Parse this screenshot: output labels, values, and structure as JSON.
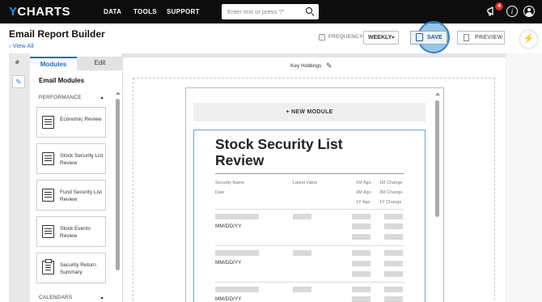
{
  "nav": {
    "logo_y": "Y",
    "logo_rest": "CHARTS",
    "links": [
      "DATA",
      "TOOLS",
      "SUPPORT"
    ],
    "search_placeholder": "Enter text or press \"/\"",
    "notification_count": "4",
    "info_glyph": "i"
  },
  "header": {
    "title": "Email Report Builder",
    "view_all": "View All",
    "frequency_label": "FREQUENCY:",
    "frequency_help": "?",
    "frequency_value": "WEEKLY",
    "save_label": "SAVE",
    "preview_label": "PREVIEW",
    "bolt_glyph": "⚡"
  },
  "rail": {
    "link_glyph": "🔗",
    "edit_glyph": "✎"
  },
  "panel": {
    "tabs": [
      "Modules",
      "Edit"
    ],
    "title": "Email Modules",
    "sections": [
      "PERFORMANCE",
      "CALENDARS"
    ],
    "modules": [
      {
        "label": "Economic Review",
        "icon": "list-icon"
      },
      {
        "label": "Stock Security List Review",
        "icon": "list-icon"
      },
      {
        "label": "Fund Security List Review",
        "icon": "list-icon"
      },
      {
        "label": "Stock Events Review",
        "icon": "list-icon"
      },
      {
        "label": "Security Return Summary",
        "icon": "clipboard-icon"
      }
    ]
  },
  "canvas": {
    "key_holdings": "Key Holdings",
    "pencil_glyph": "✎",
    "new_module": "+ NEW MODULE",
    "report_title": "Stock Security List Review",
    "headers": {
      "security_name": "Security Name",
      "date": "Date",
      "latest_value": "Latest Value",
      "ago_1m": "1M Ago",
      "ago_3m": "3M Ago",
      "ago_1y": "1Y Ago",
      "change_1m": "1M Change",
      "change_3m": "3M Change",
      "change_1y": "1Y Change"
    },
    "rows": [
      "MM/DD/YY",
      "MM/DD/YY",
      "MM/DD/YY"
    ]
  },
  "colors": {
    "accent": "#1a6dc2",
    "nav_bg": "#0d0d0d",
    "badge": "#d32f2f"
  }
}
